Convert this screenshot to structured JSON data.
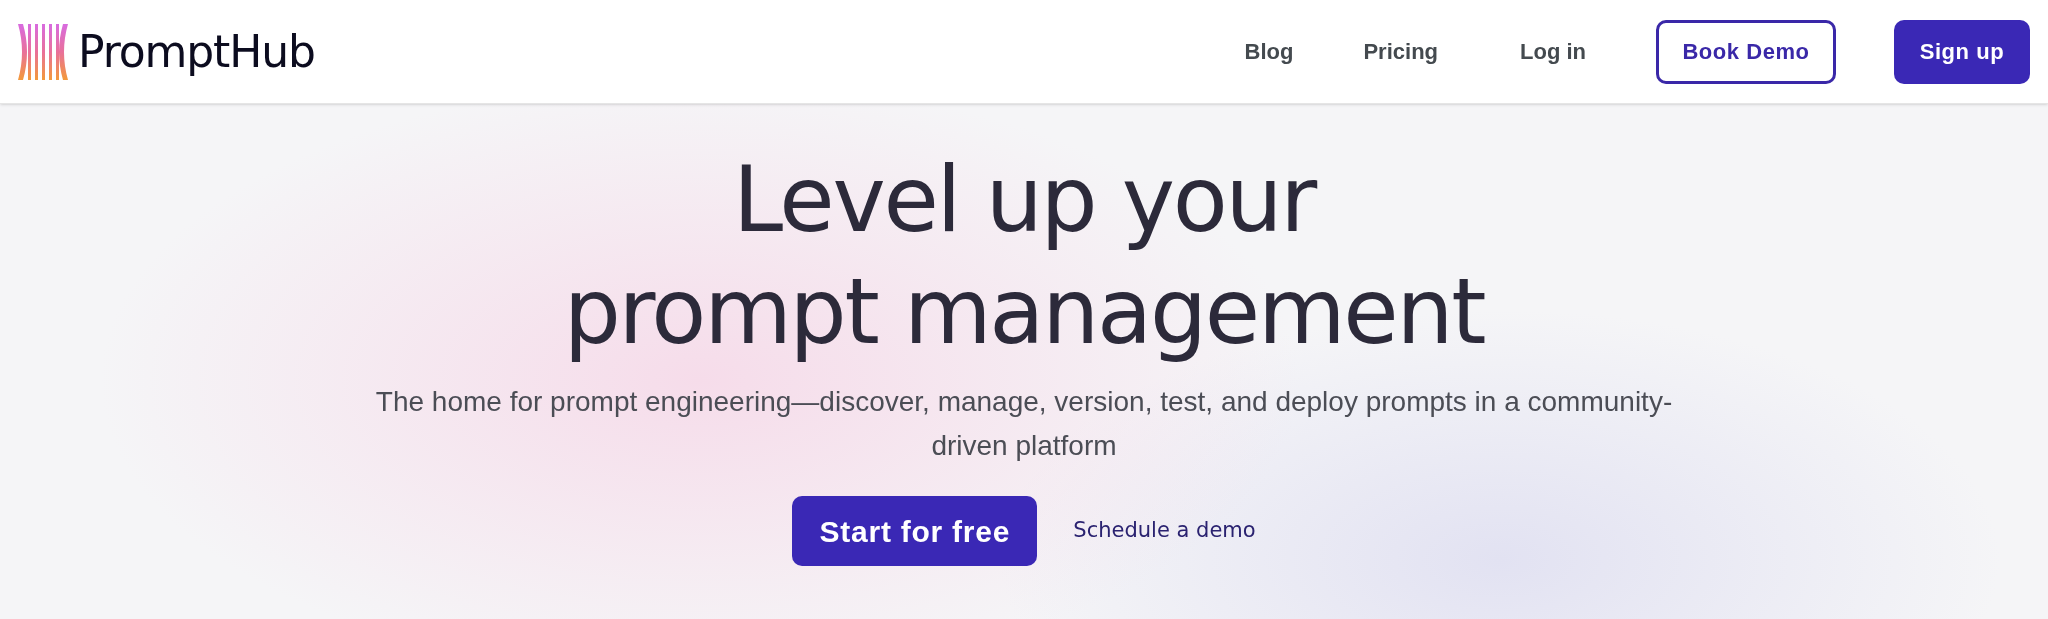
{
  "header": {
    "logo_text": "PromptHub",
    "nav_links": [
      "Blog",
      "Pricing",
      "Log in"
    ],
    "buttons": [
      {
        "label": "Book Demo",
        "kind": "outline"
      },
      {
        "label": "Sign up",
        "kind": "solid"
      }
    ]
  },
  "hero": {
    "headline_lines": [
      "Level up your",
      "prompt management"
    ],
    "subtitle": "The home for prompt engineering—discover, manage, version, test, and deploy prompts in a community-driven platform",
    "primary_button": "Start for free",
    "secondary_link": "Schedule a demo"
  }
}
